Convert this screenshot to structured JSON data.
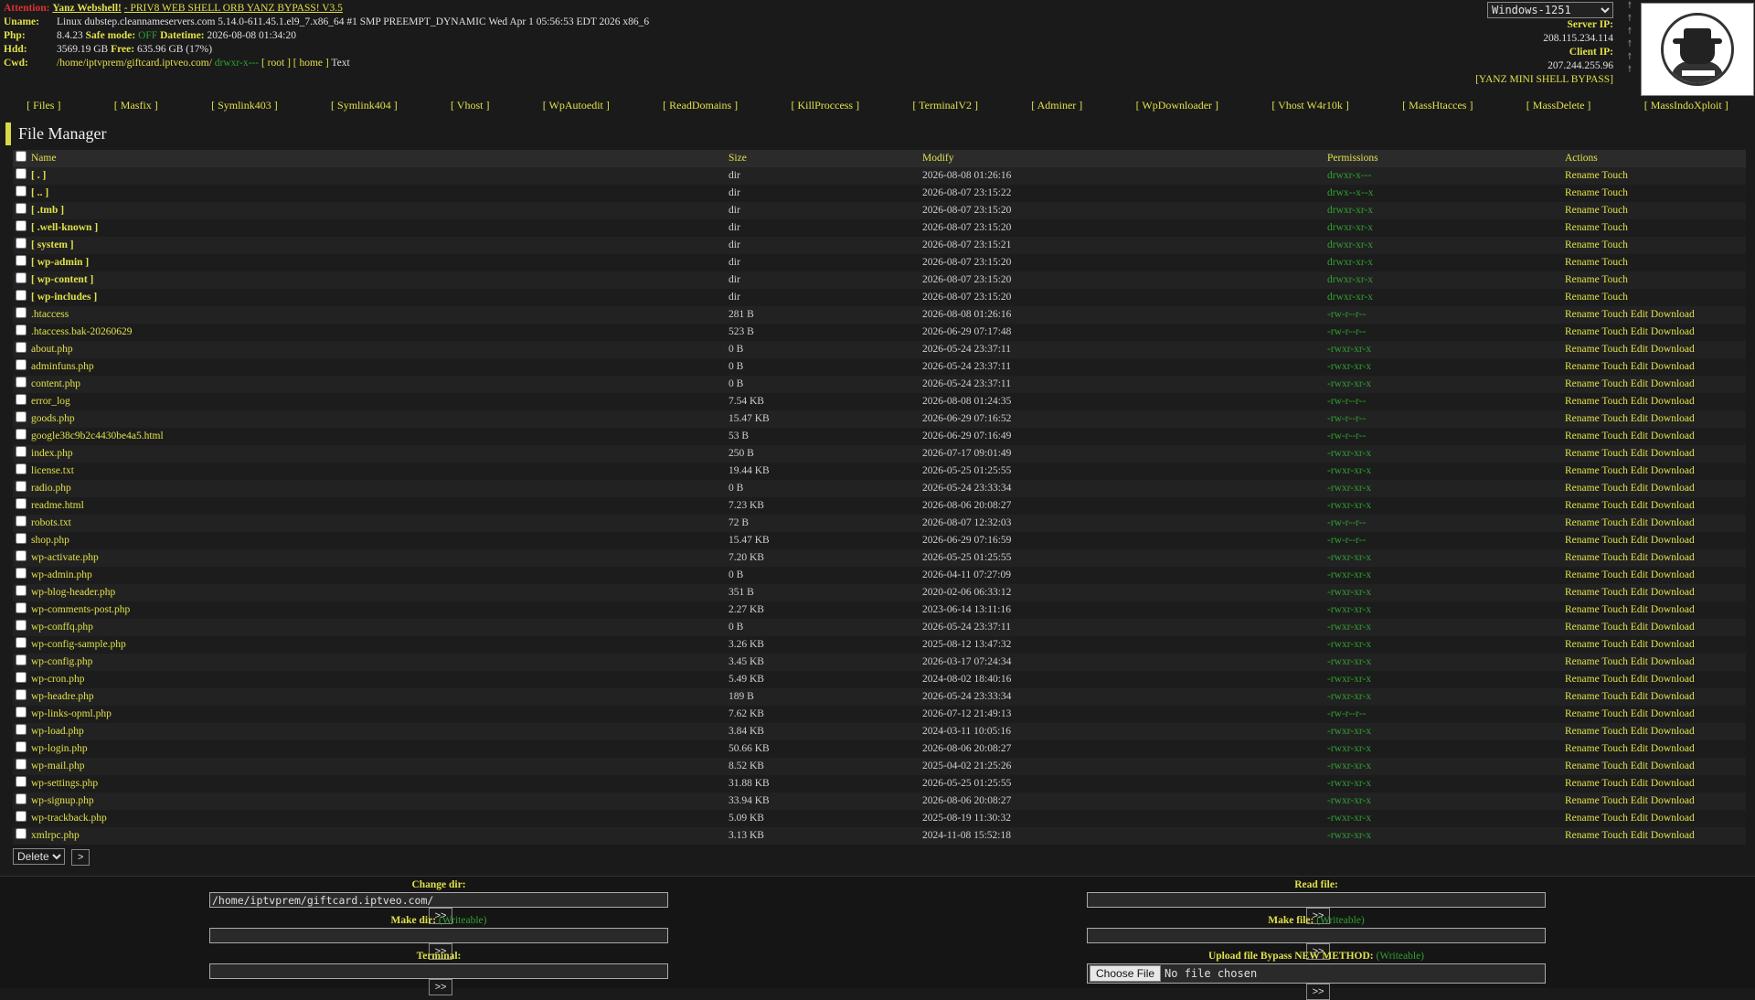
{
  "header": {
    "attention_label": "Attention:",
    "title_link": "Yanz Webshell!",
    "title_rest": "- PRIV8 WEB SHELL ORB YANZ BYPASS! V3.5",
    "uname_label": "Uname:",
    "uname": "Linux dubstep.cleannameservers.com 5.14.0-611.45.1.el9_7.x86_64 #1 SMP PREEMPT_DYNAMIC Wed Apr 1 05:56:53 EDT 2026 x86_6",
    "php_label": "Php:",
    "php_version": "8.4.23",
    "safe_mode_label": "Safe mode:",
    "safe_mode": "OFF",
    "datetime_label": "Datetime:",
    "datetime": "2026-08-08 01:34:20",
    "hdd_label": "Hdd:",
    "hdd_total": "3569.19 GB",
    "free_label": "Free:",
    "hdd_free": "635.96 GB (17%)",
    "cwd_label": "Cwd:",
    "cwd_path": "/home/iptvprem/giftcard.iptveo.com/",
    "cwd_perm": "drwxr-x---",
    "root_link": "[ root ]",
    "home_link": "[ home ]",
    "text_label": "Text"
  },
  "right": {
    "encoding": "Windows-1251",
    "server_ip_label": "Server IP:",
    "server_ip": "208.115.234.114",
    "client_ip_label": "Client IP:",
    "client_ip": "207.244.255.96",
    "bypass_link": "[YANZ MINI SHELL BYPASS]"
  },
  "menu": [
    "[ Files ]",
    "[ Masfix ]",
    "[ Symlink403 ]",
    "[ Symlink404 ]",
    "[ Vhost ]",
    "[ WpAutoedit ]",
    "[ ReadDomains ]",
    "[ KillProccess ]",
    "[ TerminalV2 ]",
    "[ Adminer ]",
    "[ WpDownloader ]",
    "[ Vhost W4r10k ]",
    "[ MassHtacces ]",
    "[ MassDelete ]",
    "[ MassIndoXploit ]"
  ],
  "file_manager": {
    "title": "File Manager",
    "columns": {
      "name": "Name",
      "size": "Size",
      "modify": "Modify",
      "permissions": "Permissions",
      "actions": "Actions"
    },
    "rows": [
      {
        "name": "[ . ]",
        "size": "dir",
        "modify": "2026-08-08 01:26:16",
        "perm": "drwxr-x---",
        "actions": "Rename Touch",
        "dir": true
      },
      {
        "name": "[ .. ]",
        "size": "dir",
        "modify": "2026-08-07 23:15:22",
        "perm": "drwx--x--x",
        "actions": "Rename Touch",
        "dir": true
      },
      {
        "name": "[ .tmb ]",
        "size": "dir",
        "modify": "2026-08-07 23:15:20",
        "perm": "drwxr-xr-x",
        "actions": "Rename Touch",
        "dir": true
      },
      {
        "name": "[ .well-known ]",
        "size": "dir",
        "modify": "2026-08-07 23:15:20",
        "perm": "drwxr-xr-x",
        "actions": "Rename Touch",
        "dir": true
      },
      {
        "name": "[ system ]",
        "size": "dir",
        "modify": "2026-08-07 23:15:21",
        "perm": "drwxr-xr-x",
        "actions": "Rename Touch",
        "dir": true
      },
      {
        "name": "[ wp-admin ]",
        "size": "dir",
        "modify": "2026-08-07 23:15:20",
        "perm": "drwxr-xr-x",
        "actions": "Rename Touch",
        "dir": true
      },
      {
        "name": "[ wp-content ]",
        "size": "dir",
        "modify": "2026-08-07 23:15:20",
        "perm": "drwxr-xr-x",
        "actions": "Rename Touch",
        "dir": true
      },
      {
        "name": "[ wp-includes ]",
        "size": "dir",
        "modify": "2026-08-07 23:15:20",
        "perm": "drwxr-xr-x",
        "actions": "Rename Touch",
        "dir": true
      },
      {
        "name": ".htaccess",
        "size": "281 B",
        "modify": "2026-08-08 01:26:16",
        "perm": "-rw-r--r--",
        "actions": "Rename Touch Edit Download"
      },
      {
        "name": ".htaccess.bak-20260629",
        "size": "523 B",
        "modify": "2026-06-29 07:17:48",
        "perm": "-rw-r--r--",
        "actions": "Rename Touch Edit Download"
      },
      {
        "name": "about.php",
        "size": "0 B",
        "modify": "2026-05-24 23:37:11",
        "perm": "-rwxr-xr-x",
        "actions": "Rename Touch Edit Download"
      },
      {
        "name": "adminfuns.php",
        "size": "0 B",
        "modify": "2026-05-24 23:37:11",
        "perm": "-rwxr-xr-x",
        "actions": "Rename Touch Edit Download"
      },
      {
        "name": "content.php",
        "size": "0 B",
        "modify": "2026-05-24 23:37:11",
        "perm": "-rwxr-xr-x",
        "actions": "Rename Touch Edit Download"
      },
      {
        "name": "error_log",
        "size": "7.54 KB",
        "modify": "2026-08-08 01:24:35",
        "perm": "-rw-r--r--",
        "actions": "Rename Touch Edit Download"
      },
      {
        "name": "goods.php",
        "size": "15.47 KB",
        "modify": "2026-06-29 07:16:52",
        "perm": "-rw-r--r--",
        "actions": "Rename Touch Edit Download"
      },
      {
        "name": "google38c9b2c4430be4a5.html",
        "size": "53 B",
        "modify": "2026-06-29 07:16:49",
        "perm": "-rw-r--r--",
        "actions": "Rename Touch Edit Download"
      },
      {
        "name": "index.php",
        "size": "250 B",
        "modify": "2026-07-17 09:01:49",
        "perm": "-rwxr-xr-x",
        "actions": "Rename Touch Edit Download"
      },
      {
        "name": "license.txt",
        "size": "19.44 KB",
        "modify": "2026-05-25 01:25:55",
        "perm": "-rwxr-xr-x",
        "actions": "Rename Touch Edit Download"
      },
      {
        "name": "radio.php",
        "size": "0 B",
        "modify": "2026-05-24 23:33:34",
        "perm": "-rwxr-xr-x",
        "actions": "Rename Touch Edit Download"
      },
      {
        "name": "readme.html",
        "size": "7.23 KB",
        "modify": "2026-08-06 20:08:27",
        "perm": "-rwxr-xr-x",
        "actions": "Rename Touch Edit Download"
      },
      {
        "name": "robots.txt",
        "size": "72 B",
        "modify": "2026-08-07 12:32:03",
        "perm": "-rw-r--r--",
        "actions": "Rename Touch Edit Download"
      },
      {
        "name": "shop.php",
        "size": "15.47 KB",
        "modify": "2026-06-29 07:16:59",
        "perm": "-rw-r--r--",
        "actions": "Rename Touch Edit Download"
      },
      {
        "name": "wp-activate.php",
        "size": "7.20 KB",
        "modify": "2026-05-25 01:25:55",
        "perm": "-rwxr-xr-x",
        "actions": "Rename Touch Edit Download"
      },
      {
        "name": "wp-admin.php",
        "size": "0 B",
        "modify": "2026-04-11 07:27:09",
        "perm": "-rwxr-xr-x",
        "actions": "Rename Touch Edit Download"
      },
      {
        "name": "wp-blog-header.php",
        "size": "351 B",
        "modify": "2020-02-06 06:33:12",
        "perm": "-rwxr-xr-x",
        "actions": "Rename Touch Edit Download"
      },
      {
        "name": "wp-comments-post.php",
        "size": "2.27 KB",
        "modify": "2023-06-14 13:11:16",
        "perm": "-rwxr-xr-x",
        "actions": "Rename Touch Edit Download"
      },
      {
        "name": "wp-conffq.php",
        "size": "0 B",
        "modify": "2026-05-24 23:37:11",
        "perm": "-rwxr-xr-x",
        "actions": "Rename Touch Edit Download"
      },
      {
        "name": "wp-config-sample.php",
        "size": "3.26 KB",
        "modify": "2025-08-12 13:47:32",
        "perm": "-rwxr-xr-x",
        "actions": "Rename Touch Edit Download"
      },
      {
        "name": "wp-config.php",
        "size": "3.45 KB",
        "modify": "2026-03-17 07:24:34",
        "perm": "-rwxr-xr-x",
        "actions": "Rename Touch Edit Download"
      },
      {
        "name": "wp-cron.php",
        "size": "5.49 KB",
        "modify": "2024-08-02 18:40:16",
        "perm": "-rwxr-xr-x",
        "actions": "Rename Touch Edit Download"
      },
      {
        "name": "wp-headre.php",
        "size": "189 B",
        "modify": "2026-05-24 23:33:34",
        "perm": "-rwxr-xr-x",
        "actions": "Rename Touch Edit Download"
      },
      {
        "name": "wp-links-opml.php",
        "size": "7.62 KB",
        "modify": "2026-07-12 21:49:13",
        "perm": "-rw-r--r--",
        "actions": "Rename Touch Edit Download"
      },
      {
        "name": "wp-load.php",
        "size": "3.84 KB",
        "modify": "2024-03-11 10:05:16",
        "perm": "-rwxr-xr-x",
        "actions": "Rename Touch Edit Download"
      },
      {
        "name": "wp-login.php",
        "size": "50.66 KB",
        "modify": "2026-08-06 20:08:27",
        "perm": "-rwxr-xr-x",
        "actions": "Rename Touch Edit Download"
      },
      {
        "name": "wp-mail.php",
        "size": "8.52 KB",
        "modify": "2025-04-02 21:25:26",
        "perm": "-rwxr-xr-x",
        "actions": "Rename Touch Edit Download"
      },
      {
        "name": "wp-settings.php",
        "size": "31.88 KB",
        "modify": "2026-05-25 01:25:55",
        "perm": "-rwxr-xr-x",
        "actions": "Rename Touch Edit Download"
      },
      {
        "name": "wp-signup.php",
        "size": "33.94 KB",
        "modify": "2026-08-06 20:08:27",
        "perm": "-rwxr-xr-x",
        "actions": "Rename Touch Edit Download"
      },
      {
        "name": "wp-trackback.php",
        "size": "5.09 KB",
        "modify": "2025-08-19 11:30:32",
        "perm": "-rwxr-xr-x",
        "actions": "Rename Touch Edit Download"
      },
      {
        "name": "xmlrpc.php",
        "size": "3.13 KB",
        "modify": "2024-11-08 15:52:18",
        "perm": "-rwxr-xr-x",
        "actions": "Rename Touch Edit Download"
      }
    ],
    "bulk_action": "Delete",
    "bulk_go": ">"
  },
  "forms": {
    "change_dir_label": "Change dir:",
    "change_dir_value": "/home/iptvprem/giftcard.iptveo.com/",
    "read_file_label": "Read file:",
    "make_dir_label": "Make dir:",
    "make_file_label": "Make file:",
    "writeable": "(Writeable)",
    "terminal_label": "Terminal:",
    "upload_label": "Upload file Bypass NEW METHOD:",
    "choose_file": "Choose File",
    "no_file": "No file chosen",
    "submit": ">>"
  },
  "colors": {
    "accent": "#e0e04a",
    "perm_green": "#2fa02f",
    "attention_red": "#e03030",
    "background": "#1a1a1a"
  }
}
